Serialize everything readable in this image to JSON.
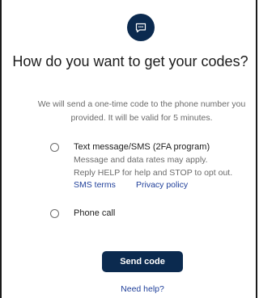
{
  "header": {
    "icon": "message-icon",
    "title": "How do you want to get your codes?"
  },
  "description": "We will send a one-time code to the phone number you provided. It will be valid for 5 minutes.",
  "options": [
    {
      "label": "Text message/SMS (2FA program)",
      "lines": [
        "Message and data rates may apply.",
        "Reply HELP for help and STOP to opt out."
      ],
      "links": [
        "SMS terms",
        "Privacy policy"
      ],
      "selected": false
    },
    {
      "label": "Phone call",
      "selected": false
    }
  ],
  "actions": {
    "send_label": "Send code",
    "help_label": "Need help?"
  },
  "colors": {
    "primary": "#0b2a4f",
    "link": "#1f3f9a"
  }
}
